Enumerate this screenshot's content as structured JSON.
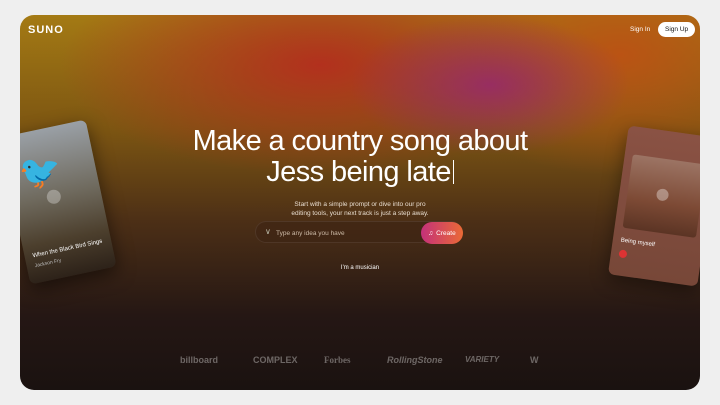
{
  "header": {
    "logo": "SUNO",
    "sign_in": "Sign In",
    "sign_up": "Sign Up"
  },
  "hero": {
    "headline_line1": "Make a country song about",
    "headline_line2": "Jess being late",
    "subtitle": "Start with a simple prompt or dive into our pro editing tools, your next track is just a step away."
  },
  "prompt": {
    "placeholder": "Type any idea you have",
    "create_label": "Create",
    "create_icon": "music-note-icon"
  },
  "musician_link": "I'm a musician",
  "cards": {
    "left": {
      "title": "When the Black Bird Sings",
      "artist": "Jackson Fry"
    },
    "right": {
      "title": "Being myself"
    }
  },
  "press_logos": [
    "billboard",
    "COMPLEX",
    "Forbes",
    "RollingStone",
    "VARIETY"
  ],
  "colors": {
    "accent_start": "#c4317a",
    "accent_end": "#ea6a36",
    "text": "#ffffff"
  }
}
